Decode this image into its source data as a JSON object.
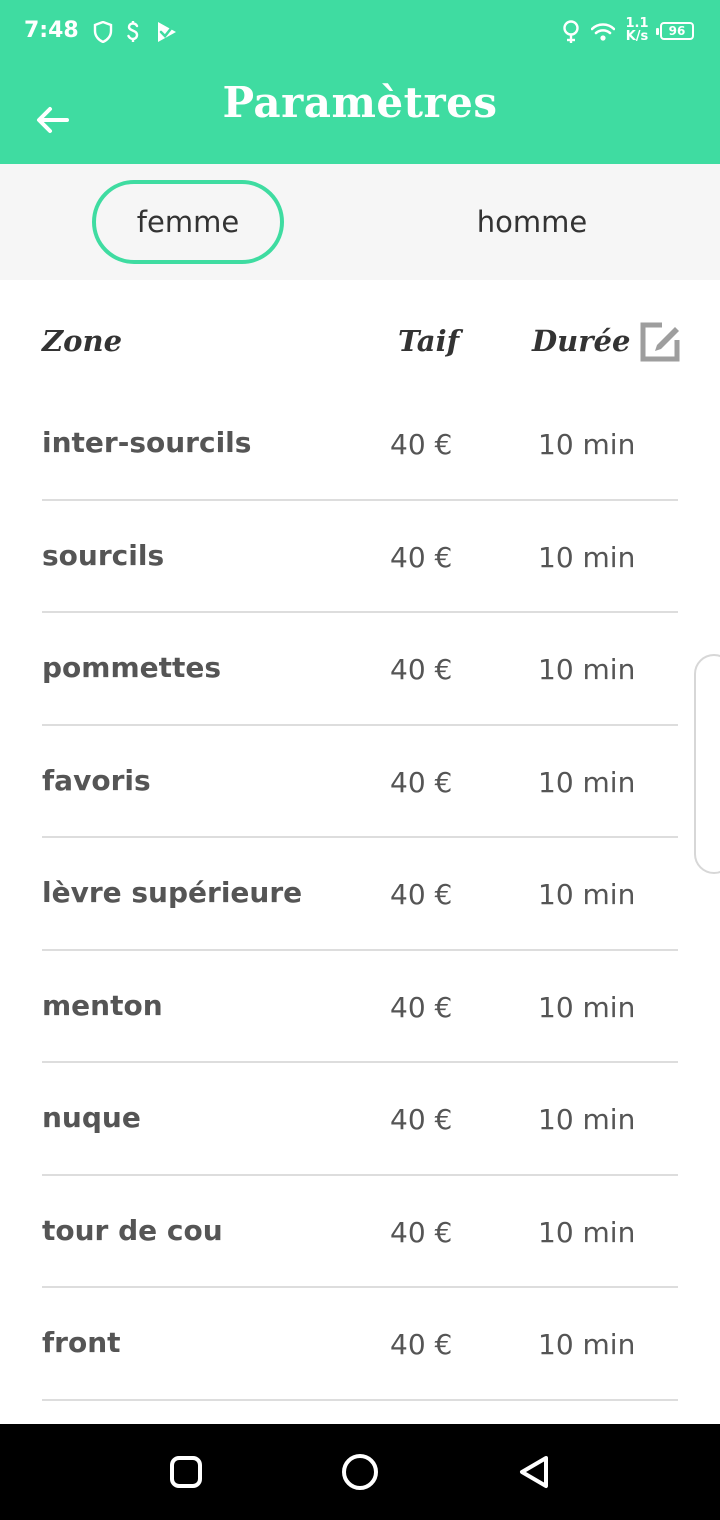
{
  "status_bar": {
    "time": "7:48",
    "net_speed_value": "1.1",
    "net_speed_unit": "K/s",
    "battery": "96",
    "icons": [
      "shield-icon",
      "dollar-icon",
      "play-check-icon",
      "location-icon",
      "wifi-icon"
    ]
  },
  "header": {
    "title": "Paramètres",
    "back_icon": "arrow-left-icon"
  },
  "tabs": [
    {
      "label": "femme",
      "selected": true
    },
    {
      "label": "homme",
      "selected": false
    }
  ],
  "table": {
    "headers": {
      "zone": "Zone",
      "tarif": "Taif",
      "duree": "Durée"
    },
    "edit_icon": "edit-icon",
    "rows": [
      {
        "zone": "inter-sourcils",
        "price": "40 €",
        "duration": "10 min"
      },
      {
        "zone": "sourcils",
        "price": "40 €",
        "duration": "10 min"
      },
      {
        "zone": "pommettes",
        "price": "40 €",
        "duration": "10 min"
      },
      {
        "zone": "favoris",
        "price": "40 €",
        "duration": "10 min"
      },
      {
        "zone": "lèvre supérieure",
        "price": "40 €",
        "duration": "10 min"
      },
      {
        "zone": "menton",
        "price": "40 €",
        "duration": "10 min"
      },
      {
        "zone": "nuque",
        "price": "40 €",
        "duration": "10 min"
      },
      {
        "zone": "tour de cou",
        "price": "40 €",
        "duration": "10 min"
      },
      {
        "zone": "front",
        "price": "40 €",
        "duration": "10 min"
      }
    ]
  },
  "nav_bar": {
    "buttons": [
      "recents-square-icon",
      "home-circle-icon",
      "back-triangle-icon"
    ]
  },
  "colors": {
    "accent": "#3fdca1",
    "text": "#555555",
    "tabs_bg": "#f6f6f6"
  }
}
